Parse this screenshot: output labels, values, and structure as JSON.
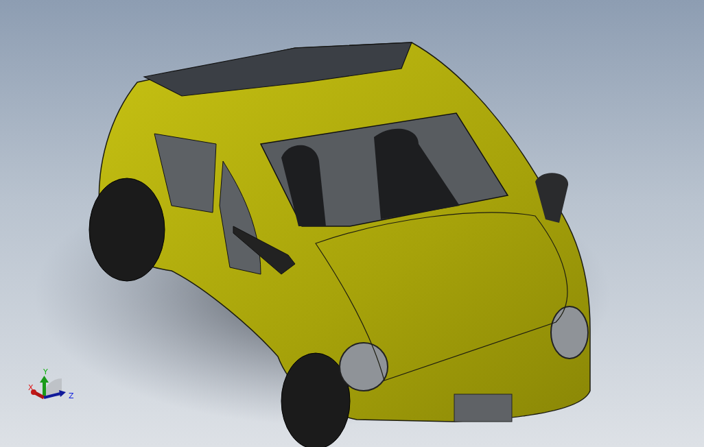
{
  "viewport": {
    "model": {
      "kind": "car"
    },
    "triad": {
      "x_label": "X",
      "y_label": "Y",
      "z_label": "Z"
    }
  }
}
